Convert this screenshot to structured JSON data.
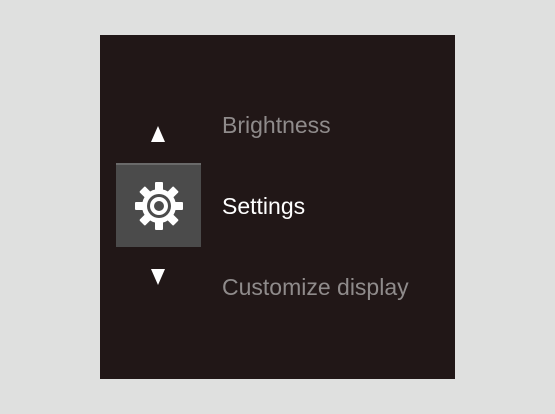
{
  "osd_menu": {
    "previous_item": {
      "label": "Brightness"
    },
    "current_item": {
      "label": "Settings",
      "icon": "gear-icon"
    },
    "next_item": {
      "label": "Customize display"
    },
    "scroll_up_icon": "triangle-up-icon",
    "scroll_down_icon": "triangle-down-icon"
  },
  "colors": {
    "page_background": "#dfe0df",
    "panel_background": "#211717",
    "selected_tile": "#4b4b4b",
    "active_text": "#ffffff",
    "inactive_text": "#8f8b8b"
  }
}
